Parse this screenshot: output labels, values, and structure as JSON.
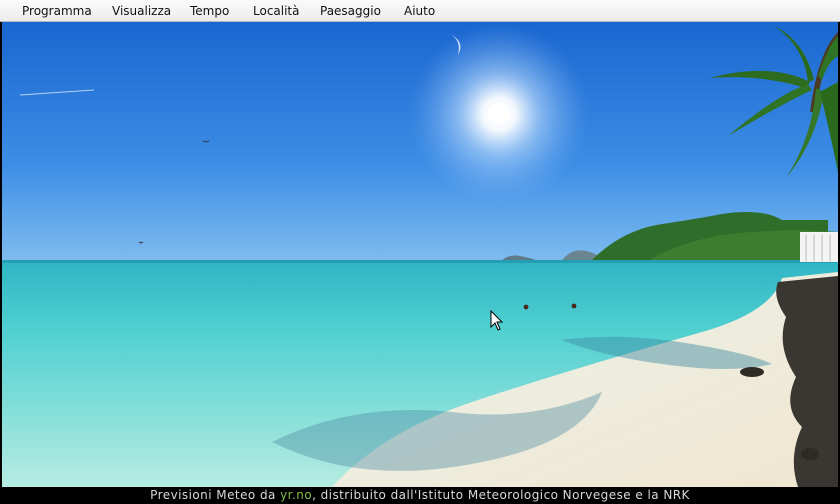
{
  "menu": {
    "items": [
      "Programma",
      "Visualizza",
      "Tempo",
      "Località",
      "Paesaggio",
      "Aiuto"
    ]
  },
  "footer": {
    "prefix": "Previsioni Meteo da ",
    "link": "yr.no",
    "suffix": ", distribuito dall'Istituto Meteorologico Norvegese e la NRK"
  },
  "colors": {
    "sky_top": "#1f6fd4",
    "sea": "#5ad6d6",
    "sand": "#efe6d3",
    "footer_link": "#7fbf4a"
  }
}
